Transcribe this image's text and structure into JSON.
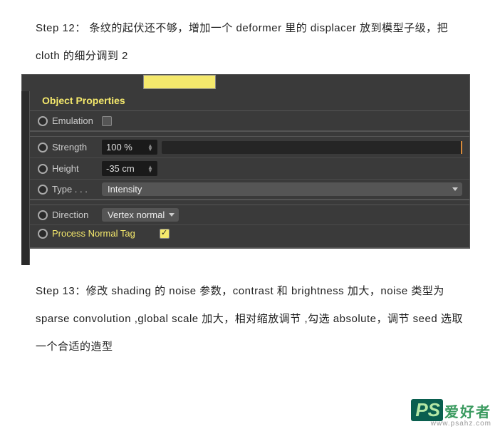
{
  "step12": "Step 12： 条纹的起伏还不够，增加一个 deformer 里的 displacer 放到模型子级，把 cloth 的细分调到 2",
  "panel": {
    "title": "Object Properties",
    "emulation": {
      "label": "Emulation"
    },
    "strength": {
      "label": "Strength",
      "value": "100 %"
    },
    "height": {
      "label": "Height",
      "value": "-35 cm"
    },
    "type": {
      "label": "Type . . .",
      "value": "Intensity"
    },
    "direction": {
      "label": "Direction",
      "value": "Vertex normal"
    },
    "process": {
      "label": "Process Normal Tag"
    }
  },
  "step13": "Step 13：修改 shading 的 noise 参数，contrast 和 brightness 加大，noise 类型为 sparse convolution ,global scale 加大，相对缩放调节 ,勾选 absolute，调节 seed 选取一个合适的造型",
  "watermark": {
    "cn": "爱好者",
    "url": "www.psahz.com"
  }
}
